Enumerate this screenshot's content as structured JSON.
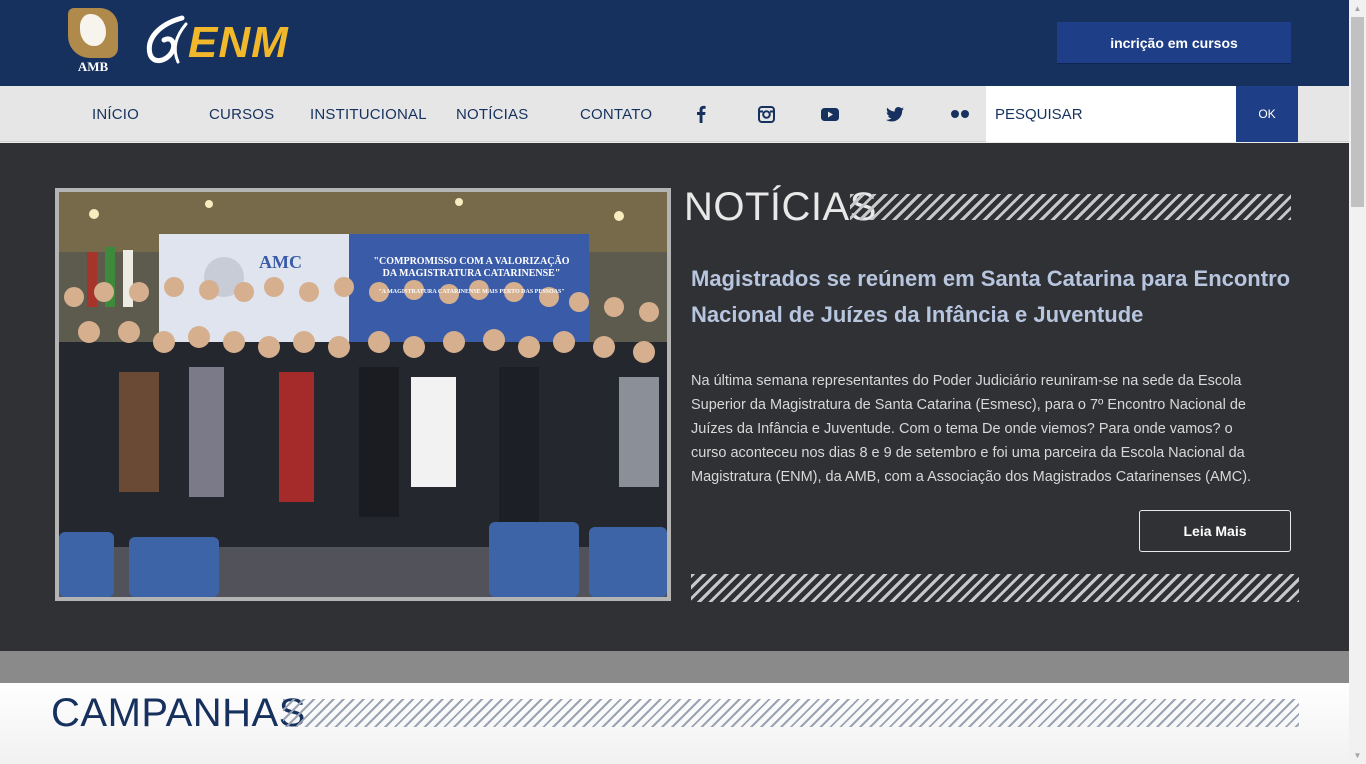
{
  "header": {
    "amb_logo_text": "AMB",
    "enm_logo_text": "ENM",
    "inscricao_label": "incrição em cursos"
  },
  "nav": {
    "items": [
      {
        "label": "INÍCIO"
      },
      {
        "label": "CURSOS"
      },
      {
        "label": "INSTITUCIONAL"
      },
      {
        "label": "NOTÍCIAS"
      },
      {
        "label": "CONTATO"
      }
    ],
    "social": [
      "facebook-icon",
      "instagram-icon",
      "youtube-icon",
      "twitter-icon",
      "flickr-icon"
    ],
    "search_placeholder": "PESQUISAR",
    "ok_label": "OK"
  },
  "news": {
    "section_title": "NOTÍCIAS",
    "article_title": "Magistrados se reúnem em Santa Catarina para Encontro Nacional de Juízes da Infância e Juventude",
    "article_body": "Na última semana representantes do Poder Judiciário reuniram-se na sede da Escola Superior da Magistratura de Santa Catarina (Esmesc), para o 7º Encontro Nacional de Juízes da Infância e Juventude. Com o tema De onde viemos? Para onde vamos? o curso aconteceu nos dias 8 e 9 de setembro e foi uma parceira da Escola Nacional da Magistratura (ENM), da AMB, com a Associação dos Magistrados Catarinenses (AMC).",
    "read_more_label": "Leia Mais",
    "photo": {
      "banner_logo": "AMC",
      "banner_line1": "\"COMPROMISSO COM A VALORIZAÇÃO",
      "banner_line2": "DA MAGISTRATURA CATARINENSE\"",
      "banner_line3": "\"A MAGISTRATURA CATARINENSE MAIS PERTO DAS PESSOAS\""
    }
  },
  "campanhas": {
    "section_title": "CAMPANHAS"
  },
  "colors": {
    "header_bg": "#16315e",
    "accent_blue": "#1e3f87",
    "enm_gold": "#f0b82a",
    "news_bg": "#2f3134"
  }
}
